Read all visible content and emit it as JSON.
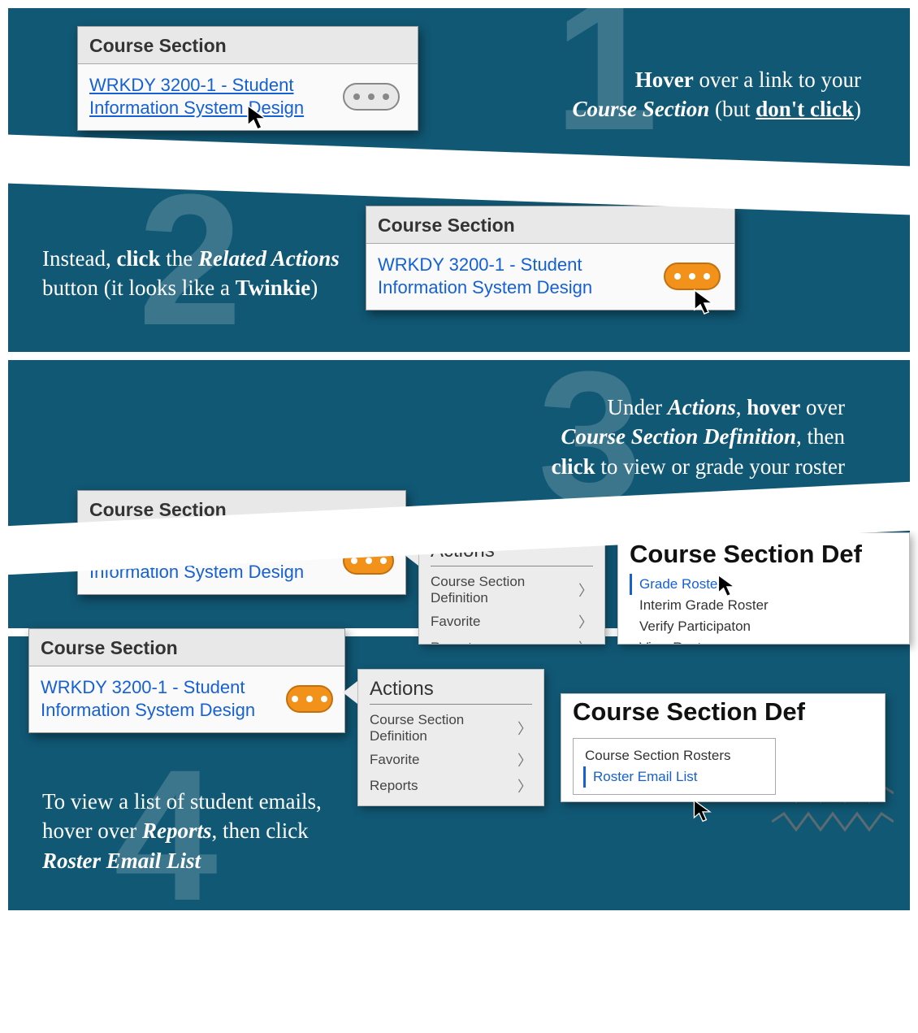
{
  "panels": {
    "one": {
      "number": "1",
      "instruction_html": "<b>Hover</b> over a link to your<br><i>Course Section</i> (but <u>don't click</u>)"
    },
    "two": {
      "number": "2",
      "instruction_html": "Instead, <b>click</b> the <i>Related Actions</i><br>button (it looks like a <b>Twinkie</b>)"
    },
    "three": {
      "number": "3",
      "instruction_html": "Under <i>Actions</i>, <b>hover</b> over<br><i>Course Section Definition</i>, then<br><b>click</b> to view or grade your roster"
    },
    "four": {
      "number": "4",
      "instruction_html": "To view a list of student emails,<br>hover over <i>Reports</i>, then click<br><i>Roster Email List</i>"
    }
  },
  "card": {
    "header": "Course Section",
    "link_text": "WRKDY 3200-1 - Student Information System Design"
  },
  "actions": {
    "title": "Actions",
    "items": [
      "Course Section Definition",
      "Favorite",
      "Reports"
    ]
  },
  "submenu3": {
    "heading": "Course Section Def",
    "items": [
      "Grade Roster",
      "Interim Grade Roster",
      "Verify Participaton",
      "View Roster"
    ],
    "selected": "Grade Roster"
  },
  "submenu4": {
    "heading": "Course Section Def",
    "box_items": [
      "Course Section Rosters",
      "Roster Email List"
    ],
    "selected": "Roster Email List"
  }
}
